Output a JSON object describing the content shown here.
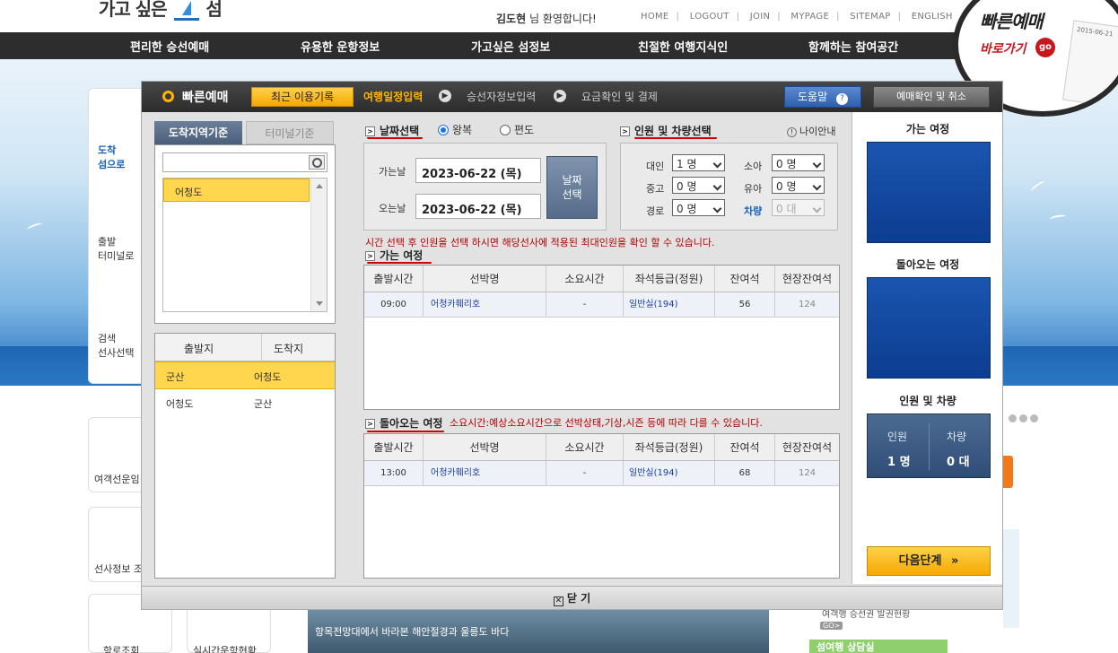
{
  "site": {
    "logo_text": "가고 싶은",
    "logo_tail": "섬",
    "welcome_name": "김도현",
    "welcome_suffix": " 님 환영합니다!",
    "top_links": [
      "HOME",
      "LOGOUT",
      "JOIN",
      "MYPAGE",
      "SITEMAP",
      "ENGLISH"
    ],
    "nav": [
      "편리한 승선예매",
      "유용한 운항정보",
      "가고싶은 섬정보",
      "친절한 여행지식인",
      "함께하는 참여공간"
    ],
    "quick_badge": {
      "title": "빠른예매",
      "link": "바로가기",
      "go": "go",
      "ticket_text": "2015-06-21"
    },
    "side_labels": [
      "도착",
      "섬으로",
      "출발",
      "터미널로",
      "검색",
      "선사선택",
      "여객선운임",
      "선사정보 조",
      "항로조회",
      "실시간운항현황"
    ],
    "photo_caption": "항목전망대에서 바라본 해안절경과 울릉도 바다",
    "right_caption": "여객행 승선권 발권현황",
    "right_go": "GO>",
    "right_green": "섬여행 상담실"
  },
  "modal": {
    "title": "빠른예매",
    "recent_button": "최근 이용기록",
    "steps": [
      "여행일정입력",
      "승선자정보입력",
      "요금확인 및 결제"
    ],
    "help_button": "도움말",
    "help_icon": "?",
    "confirm_button": "예매확인 및 취소",
    "close_label": "닫 기",
    "left": {
      "tab_active": "도착지역기준",
      "tab_inactive": "터미널기준",
      "search_placeholder": "",
      "selected_area": "어청도",
      "route_header": [
        "출발지",
        "도착지"
      ],
      "routes": [
        {
          "from": "군산",
          "to": "어청도",
          "selected": true
        },
        {
          "from": "어청도",
          "to": "군산",
          "selected": false
        }
      ]
    },
    "date_section": {
      "label": "날짜선택",
      "trip_types": [
        "왕복",
        "편도"
      ],
      "selected_trip": "왕복",
      "depart_label": "가는날",
      "depart_date": "2023-06-22 (목)",
      "return_label": "오는날",
      "return_date": "2023-06-22 (목)",
      "select_button_line1": "날짜",
      "select_button_line2": "선택"
    },
    "pax_section": {
      "label": "인원 및 차량선택",
      "age_info": "나이안내",
      "adult_label": "대인",
      "adult_value": "1 명",
      "child_label": "소아",
      "child_value": "0 명",
      "youth_label": "중고",
      "youth_value": "0 명",
      "infant_label": "유아",
      "infant_value": "0 명",
      "senior_label": "경로",
      "senior_value": "0 명",
      "car_label": "차량",
      "car_value": "0 대"
    },
    "notice": "시간 선택 후 인원을 선택 하시면 해당선사에 적용된 최대인원을 확인 할 수 있습니다.",
    "outbound": {
      "label": "가는 여정",
      "headers": [
        "출발시간",
        "선박명",
        "소요시간",
        "좌석등급(정원)",
        "잔여석",
        "현장잔여석"
      ],
      "rows": [
        {
          "time": "09:00",
          "ship": "어청카훼리호",
          "duration": "-",
          "grade": "일반실(194)",
          "remain": "56",
          "onsite": "124"
        }
      ]
    },
    "return": {
      "label": "돌아오는 여정",
      "note": "소요시간:예상소요시간으로 선박상태,기상,시즌 등에 따라 다를 수 있습니다.",
      "headers": [
        "출발시간",
        "선박명",
        "소요시간",
        "좌석등급(정원)",
        "잔여석",
        "현장잔여석"
      ],
      "rows": [
        {
          "time": "13:00",
          "ship": "어청카훼리호",
          "duration": "-",
          "grade": "일반실(194)",
          "remain": "68",
          "onsite": "124"
        }
      ]
    },
    "right": {
      "outbound_title": "가는 여정",
      "return_title": "돌아오는 여정",
      "pax_title": "인원 및 차량",
      "pax_key": "인원",
      "pax_value": "1 명",
      "car_key": "차량",
      "car_value": "0 대",
      "next_button": "다음단계",
      "next_icon": "»"
    }
  },
  "colors": {
    "accent": "#ffb400",
    "header_dark": "#2d2d2d",
    "selected_row": "#ffd64e",
    "blue_panel": "#1a55b0",
    "notice_red": "#b30000"
  },
  "icons": [
    "search-icon",
    "help-icon",
    "arrow-right-icon",
    "close-icon",
    "info-icon",
    "chevron-down-icon",
    "double-chevron-right-icon"
  ]
}
